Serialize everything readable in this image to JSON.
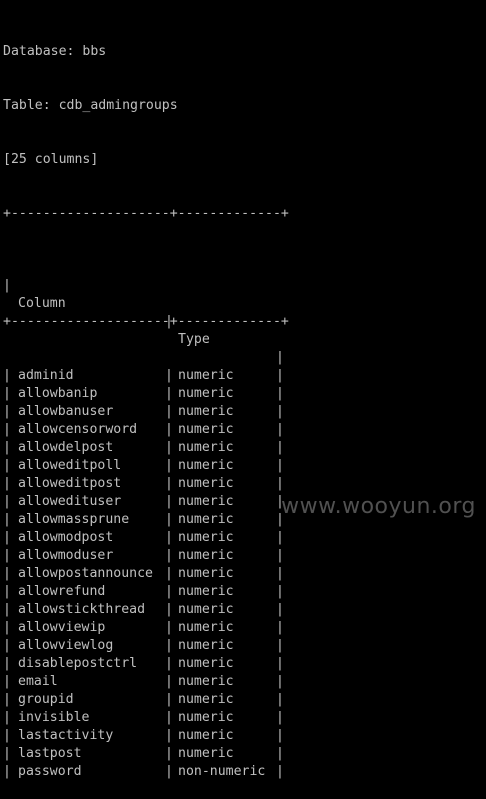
{
  "header": {
    "database_line": "Database: bbs",
    "table_line": "Table: cdb_admingroups",
    "columns_line": "[25 columns]"
  },
  "table": {
    "border_top": "+--------------------+-------------+",
    "border_mid": "+--------------------+-------------+",
    "headers": [
      "Column",
      "Type"
    ],
    "rows": [
      [
        "adminid",
        "numeric"
      ],
      [
        "allowbanip",
        "numeric"
      ],
      [
        "allowbanuser",
        "numeric"
      ],
      [
        "allowcensorword",
        "numeric"
      ],
      [
        "allowdelpost",
        "numeric"
      ],
      [
        "alloweditpoll",
        "numeric"
      ],
      [
        "alloweditpost",
        "numeric"
      ],
      [
        "allowedituser",
        "numeric"
      ],
      [
        "allowmassprune",
        "numeric"
      ],
      [
        "allowmodpost",
        "numeric"
      ],
      [
        "allowmoduser",
        "numeric"
      ],
      [
        "allowpostannounce",
        "numeric"
      ],
      [
        "allowrefund",
        "numeric"
      ],
      [
        "allowstickthread",
        "numeric"
      ],
      [
        "allowviewip",
        "numeric"
      ],
      [
        "allowviewlog",
        "numeric"
      ],
      [
        "disablepostctrl",
        "numeric"
      ],
      [
        "email",
        "numeric"
      ],
      [
        "groupid",
        "numeric"
      ],
      [
        "invisible",
        "numeric"
      ],
      [
        "lastactivity",
        "numeric"
      ],
      [
        "lastpost",
        "numeric"
      ],
      [
        "password",
        "non-numeric"
      ]
    ]
  },
  "watermark": "www.wooyun.org",
  "colors": {
    "background": "#000000",
    "text": "#c0c0c0",
    "watermark": "#5a5a5a"
  }
}
